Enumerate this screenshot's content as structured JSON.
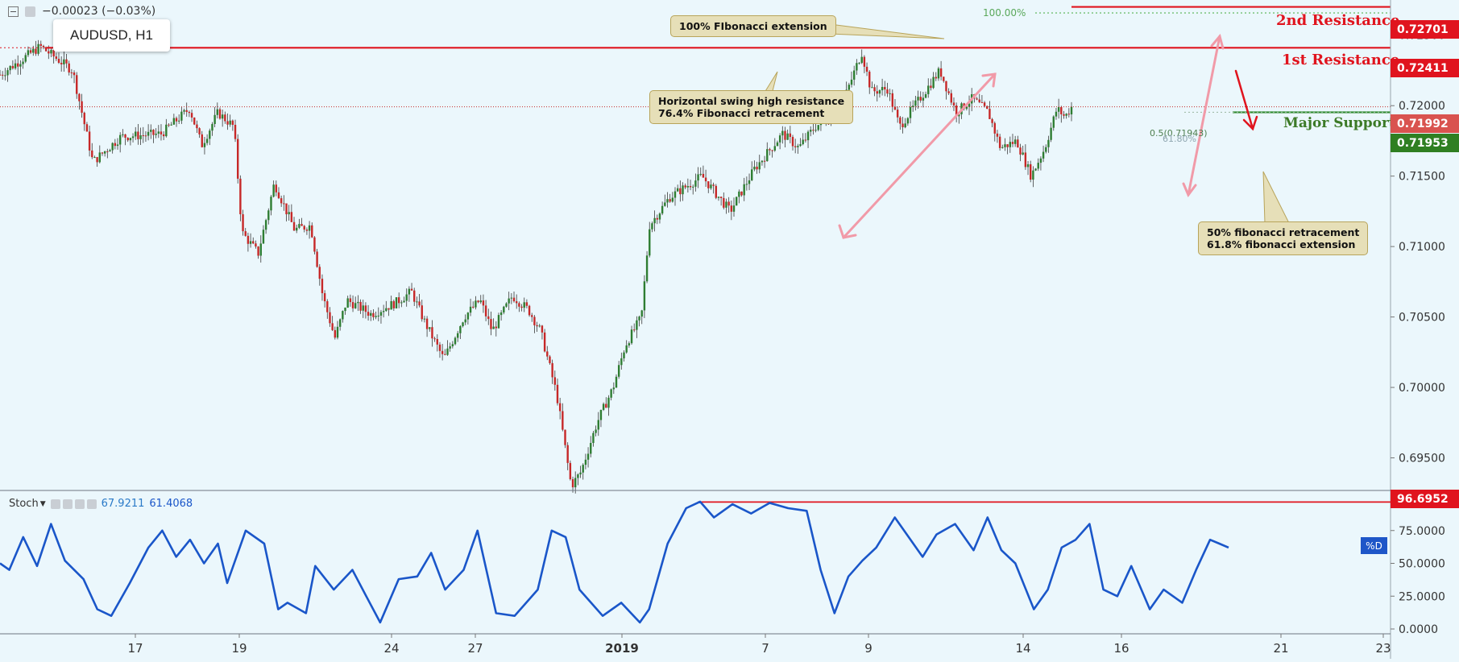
{
  "header": {
    "change": "−0.00023 (−0.03%)",
    "symbol_label": "AUDUSD, H1"
  },
  "annotations": {
    "fib_ext_100": "100% FIbonacci extension",
    "swing_high_line1": "Horizontal swing high resistance",
    "swing_high_line2": "76.4% Fibonacci retracement",
    "fib50_line1": "50% fibonacci retracement",
    "fib50_line2": "61.8% fibonacci extension",
    "resistance2": "2nd Resistance",
    "resistance1": "1st Resistance",
    "major_support": "Major Support",
    "fib_100_tag": "100.00%",
    "fib_05_tag": "0.5(0.71943)",
    "fib_618_tag": "61.80%"
  },
  "price_tags": {
    "r2": "0.72701",
    "r1": "0.72411",
    "last": "0.71992",
    "support": "0.71953",
    "stoch_level": "96.6952"
  },
  "stoch": {
    "name": "Stoch",
    "k_value": "67.9211",
    "d_value": "61.4068",
    "d_label": "%D"
  },
  "colors": {
    "background": "#ebf7fc",
    "up_candle": "#2e7d32",
    "down_candle": "#c62828",
    "resistance": "#e0141e",
    "support": "#3c7a27",
    "stoch_line": "#1a56c9",
    "arrow_pink": "#f19aa8"
  },
  "chart_data": {
    "type": "candlestick",
    "symbol": "AUDUSD",
    "timeframe": "H1",
    "price_axis": {
      "min": 0.6928,
      "max": 0.7275,
      "ticks": [
        "0.72500",
        "0.72000",
        "0.71500",
        "0.71000",
        "0.70500",
        "0.70000",
        "0.69500"
      ]
    },
    "x_tick_labels": [
      "17",
      "19",
      "24",
      "27",
      "2019",
      "7",
      "9",
      "14",
      "16",
      "21",
      "23"
    ],
    "levels": {
      "resistance_2": 0.72701,
      "resistance_1": 0.72411,
      "major_support": 0.71953,
      "last_price": 0.71992,
      "fib_100": 0.72658
    },
    "price_path": [
      [
        0,
        0.7222
      ],
      [
        50,
        0.7242
      ],
      [
        90,
        0.7225
      ],
      [
        115,
        0.716
      ],
      [
        150,
        0.7178
      ],
      [
        200,
        0.718
      ],
      [
        235,
        0.7198
      ],
      [
        250,
        0.7172
      ],
      [
        270,
        0.7195
      ],
      [
        290,
        0.7185
      ],
      [
        300,
        0.711
      ],
      [
        320,
        0.7095
      ],
      [
        340,
        0.7145
      ],
      [
        365,
        0.7112
      ],
      [
        385,
        0.7115
      ],
      [
        400,
        0.7065
      ],
      [
        415,
        0.7035
      ],
      [
        430,
        0.7062
      ],
      [
        460,
        0.7052
      ],
      [
        490,
        0.706
      ],
      [
        510,
        0.7068
      ],
      [
        525,
        0.7048
      ],
      [
        550,
        0.702
      ],
      [
        575,
        0.705
      ],
      [
        595,
        0.7062
      ],
      [
        610,
        0.704
      ],
      [
        635,
        0.7065
      ],
      [
        655,
        0.7055
      ],
      [
        670,
        0.704
      ],
      [
        690,
        0.6995
      ],
      [
        708,
        0.693
      ],
      [
        720,
        0.694
      ],
      [
        740,
        0.6975
      ],
      [
        760,
        0.7
      ],
      [
        775,
        0.703
      ],
      [
        795,
        0.705
      ],
      [
        805,
        0.7115
      ],
      [
        830,
        0.7135
      ],
      [
        870,
        0.715
      ],
      [
        905,
        0.7125
      ],
      [
        935,
        0.7155
      ],
      [
        970,
        0.718
      ],
      [
        990,
        0.717
      ],
      [
        1010,
        0.7185
      ],
      [
        1040,
        0.7195
      ],
      [
        1068,
        0.7238
      ],
      [
        1080,
        0.721
      ],
      [
        1100,
        0.7212
      ],
      [
        1115,
        0.7185
      ],
      [
        1140,
        0.7205
      ],
      [
        1165,
        0.7225
      ],
      [
        1185,
        0.7195
      ],
      [
        1205,
        0.7205
      ],
      [
        1225,
        0.7195
      ],
      [
        1240,
        0.717
      ],
      [
        1260,
        0.7175
      ],
      [
        1278,
        0.715
      ],
      [
        1295,
        0.717
      ],
      [
        1310,
        0.7198
      ],
      [
        1320,
        0.7192
      ],
      [
        1328,
        0.7199
      ]
    ],
    "stoch_axis": {
      "min": 0,
      "max": 100,
      "ticks": [
        "75.0000",
        "50.0000",
        "25.0000",
        "0.0000"
      ]
    },
    "stoch_d_path": [
      [
        0,
        50
      ],
      [
        10,
        45
      ],
      [
        25,
        70
      ],
      [
        40,
        48
      ],
      [
        55,
        80
      ],
      [
        70,
        52
      ],
      [
        90,
        38
      ],
      [
        105,
        15
      ],
      [
        120,
        10
      ],
      [
        140,
        35
      ],
      [
        160,
        62
      ],
      [
        175,
        75
      ],
      [
        190,
        55
      ],
      [
        205,
        68
      ],
      [
        220,
        50
      ],
      [
        235,
        65
      ],
      [
        245,
        35
      ],
      [
        265,
        75
      ],
      [
        285,
        65
      ],
      [
        300,
        15
      ],
      [
        310,
        20
      ],
      [
        330,
        12
      ],
      [
        340,
        48
      ],
      [
        360,
        30
      ],
      [
        380,
        45
      ],
      [
        395,
        25
      ],
      [
        410,
        5
      ],
      [
        430,
        38
      ],
      [
        450,
        40
      ],
      [
        465,
        58
      ],
      [
        480,
        30
      ],
      [
        500,
        45
      ],
      [
        515,
        75
      ],
      [
        535,
        12
      ],
      [
        555,
        10
      ],
      [
        580,
        30
      ],
      [
        595,
        75
      ],
      [
        610,
        70
      ],
      [
        625,
        30
      ],
      [
        650,
        10
      ],
      [
        670,
        20
      ],
      [
        690,
        5
      ],
      [
        700,
        15
      ],
      [
        720,
        65
      ],
      [
        740,
        92
      ],
      [
        755,
        97
      ],
      [
        770,
        85
      ],
      [
        790,
        95
      ],
      [
        810,
        88
      ],
      [
        830,
        96
      ],
      [
        850,
        92
      ],
      [
        870,
        90
      ],
      [
        885,
        45
      ],
      [
        900,
        12
      ],
      [
        915,
        40
      ],
      [
        930,
        52
      ],
      [
        945,
        62
      ],
      [
        965,
        85
      ],
      [
        980,
        70
      ],
      [
        995,
        55
      ],
      [
        1010,
        72
      ],
      [
        1030,
        80
      ],
      [
        1050,
        60
      ],
      [
        1065,
        85
      ],
      [
        1080,
        60
      ],
      [
        1095,
        50
      ],
      [
        1115,
        15
      ],
      [
        1130,
        30
      ],
      [
        1145,
        62
      ],
      [
        1160,
        68
      ],
      [
        1175,
        80
      ],
      [
        1190,
        30
      ],
      [
        1205,
        25
      ],
      [
        1220,
        48
      ],
      [
        1240,
        15
      ],
      [
        1255,
        30
      ],
      [
        1275,
        20
      ],
      [
        1290,
        45
      ],
      [
        1305,
        68
      ],
      [
        1315,
        65
      ],
      [
        1325,
        62
      ]
    ]
  }
}
